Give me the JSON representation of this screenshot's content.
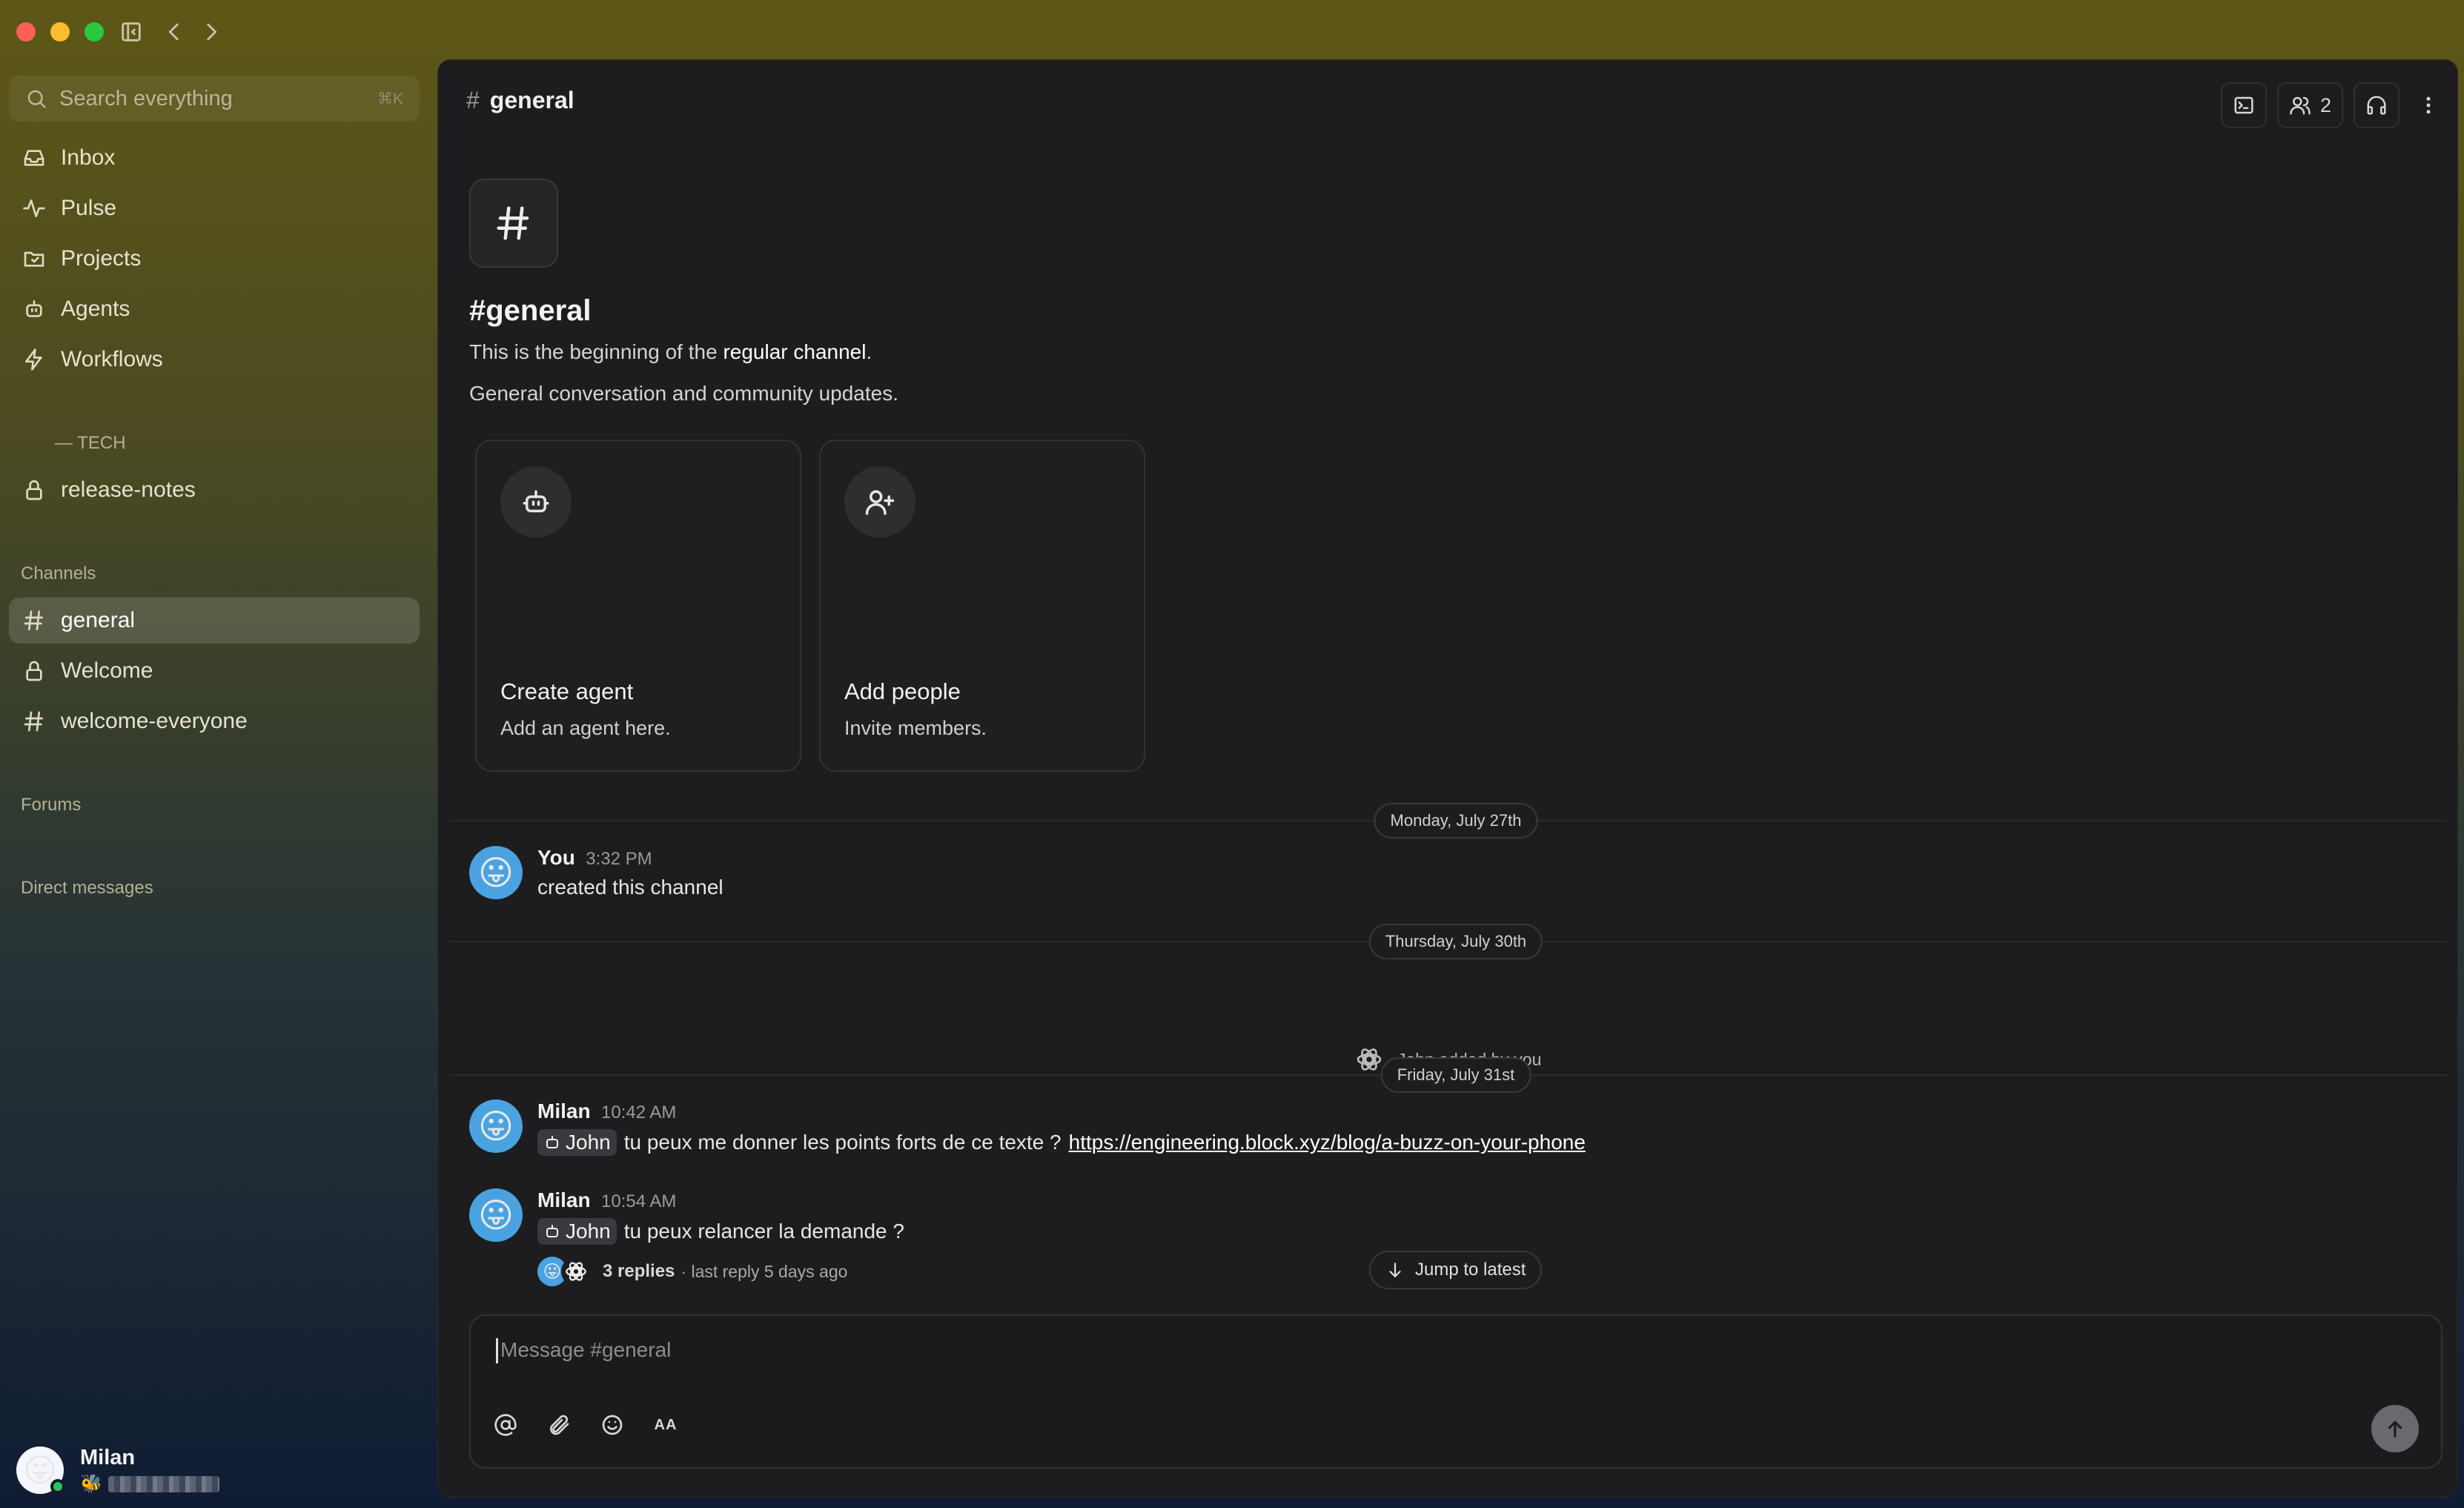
{
  "sidebar": {
    "search": {
      "placeholder": "Search everything",
      "shortcut": "⌘K"
    },
    "nav": [
      {
        "label": "Inbox",
        "icon": "inbox-icon"
      },
      {
        "label": "Pulse",
        "icon": "pulse-icon"
      },
      {
        "label": "Projects",
        "icon": "projects-icon"
      },
      {
        "label": "Agents",
        "icon": "agent-icon"
      },
      {
        "label": "Workflows",
        "icon": "bolt-icon"
      }
    ],
    "tech_section": {
      "label": "— TECH",
      "items": [
        {
          "label": "release-notes",
          "icon": "lock-icon"
        }
      ]
    },
    "channels": {
      "label": "Channels",
      "items": [
        {
          "label": "general",
          "icon": "hash-icon",
          "active": true
        },
        {
          "label": "Welcome",
          "icon": "lock-icon"
        },
        {
          "label": "welcome-everyone",
          "icon": "hash-icon"
        }
      ]
    },
    "forums_label": "Forums",
    "dm_label": "Direct messages",
    "user": {
      "name": "Milan",
      "avatar": "😛",
      "status_emoji": "🐝",
      "online": true
    }
  },
  "header": {
    "hash": "#",
    "title": "general",
    "member_count": "2",
    "buttons": [
      "terminal-icon",
      "members-icon",
      "headphones-icon",
      "more-vertical-icon"
    ]
  },
  "intro": {
    "title": "#general",
    "line1_prefix": "This is the beginning of the",
    "line1_bold": "regular channel",
    "line1_suffix": ".",
    "description": "General conversation and community updates."
  },
  "cards": [
    {
      "title": "Create agent",
      "subtitle": "Add an agent here.",
      "icon": "agent-icon"
    },
    {
      "title": "Add people",
      "subtitle": "Invite members.",
      "icon": "user-plus-icon"
    }
  ],
  "dates": [
    "Monday, July 27th",
    "Thursday, July 30th",
    "Friday, July 31st"
  ],
  "messages": [
    {
      "author": "You",
      "time": "3:32 PM",
      "text": "created this channel",
      "avatar": "😛"
    },
    {
      "author": "Milan",
      "time": "10:42 AM",
      "mention": "John",
      "text": "tu peux me donner les points forts de ce texte ?",
      "link": "https://engineering.block.xyz/blog/a-buzz-on-your-phone",
      "avatar": "😛"
    },
    {
      "author": "Milan",
      "time": "10:54 AM",
      "mention": "John",
      "text": "tu peux relancer la demande ?",
      "avatar": "😛"
    }
  ],
  "system_event": "John added by you",
  "thread": {
    "replies": "3 replies",
    "last_reply": "· last reply 5 days ago"
  },
  "jump_label": "Jump to latest",
  "composer": {
    "placeholder": "Message #general",
    "format_label": "AA"
  },
  "colors": {
    "accent_online": "#2ec259",
    "panel": "#1d1d1f",
    "sidebar_top": "#5e5716",
    "sidebar_bottom": "#101c33"
  }
}
